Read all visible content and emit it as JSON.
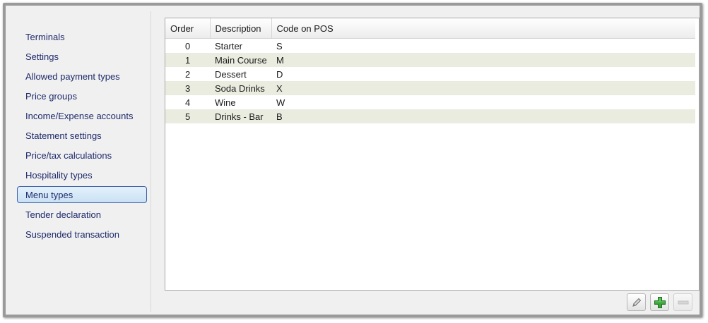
{
  "sidebar": {
    "items": [
      {
        "label": "Terminals"
      },
      {
        "label": "Settings"
      },
      {
        "label": "Allowed payment types"
      },
      {
        "label": "Price groups"
      },
      {
        "label": "Income/Expense accounts"
      },
      {
        "label": "Statement settings"
      },
      {
        "label": "Price/tax calculations"
      },
      {
        "label": "Hospitality types"
      },
      {
        "label": "Menu types",
        "active": true
      },
      {
        "label": "Tender declaration"
      },
      {
        "label": "Suspended transaction"
      }
    ]
  },
  "table": {
    "headers": [
      "Order",
      "Description",
      "Code on POS"
    ],
    "rows": [
      [
        "0",
        "Starter",
        "S"
      ],
      [
        "1",
        "Main Course",
        "M"
      ],
      [
        "2",
        "Dessert",
        "D"
      ],
      [
        "3",
        "Soda Drinks",
        "X"
      ],
      [
        "4",
        "Wine",
        "W"
      ],
      [
        "5",
        "Drinks - Bar",
        "B"
      ]
    ]
  },
  "toolbar": {
    "edit_icon": "pencil-icon",
    "add_icon": "plus-icon",
    "remove_icon": "minus-icon"
  },
  "colors": {
    "accent_border": "#3a5fa8",
    "alt_row": "#eaecdf",
    "add_green": "#3aa63a"
  }
}
